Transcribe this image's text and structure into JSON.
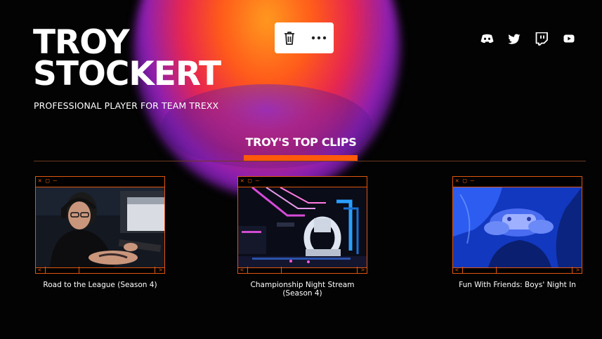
{
  "hero": {
    "name_line1": "TROY",
    "name_line2": "STOCKERT",
    "subtitle": "PROFESSIONAL PLAYER FOR TEAM TREXX"
  },
  "toolbar": {
    "icons": [
      "trash-icon",
      "more-icon"
    ]
  },
  "socials": [
    "discord-icon",
    "twitter-icon",
    "twitch-icon",
    "youtube-icon"
  ],
  "section": {
    "title": "TROY'S TOP CLIPS"
  },
  "window_controls": {
    "text": "✕ ▢ –",
    "prev": "<",
    "next": ">"
  },
  "clips": [
    {
      "title": "Road to the League (Season 4)"
    },
    {
      "title": "Championship Night Stream (Season 4)"
    },
    {
      "title": "Fun With Friends: Boys' Night In"
    }
  ],
  "colors": {
    "accent": "#ff5a0a",
    "frame": "#e0560f",
    "background": "#030303"
  }
}
